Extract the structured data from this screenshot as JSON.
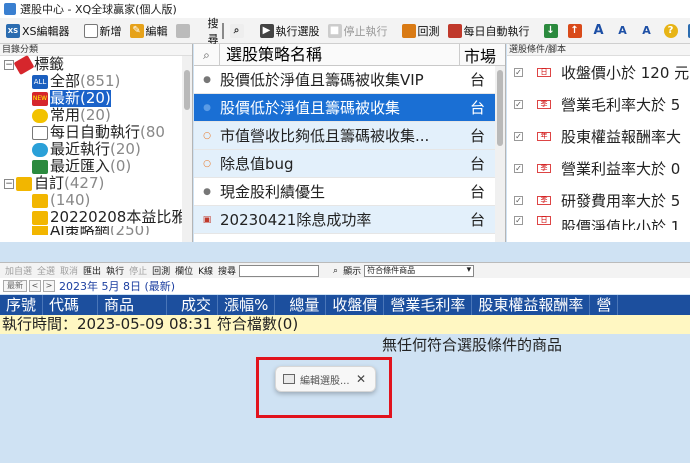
{
  "window": {
    "title": "選股中心 - XQ全球贏家(個人版)"
  },
  "toolbar": {
    "xs_editor": "XS編輯器",
    "new": "新增",
    "edit": "編輯",
    "search_label": "搜尋",
    "run": "執行選股",
    "stop": "停止執行",
    "backtest": "回測",
    "daily": "每日自動執行"
  },
  "left_panel": {
    "title": "目錄分類",
    "tree": [
      {
        "label": "標籤",
        "count": ""
      },
      {
        "label": "全部",
        "count": "(851)"
      },
      {
        "label": "最新",
        "count": "(20)"
      },
      {
        "label": "常用",
        "count": "(20)"
      },
      {
        "label": "每日自動執行",
        "count": "(80"
      },
      {
        "label": "最近執行",
        "count": "(20)"
      },
      {
        "label": "最近匯入",
        "count": "(0)"
      },
      {
        "label": "自訂",
        "count": "(427)"
      },
      {
        "label": "",
        "count": "(140)"
      },
      {
        "label": "20220208本益比雅",
        "count": ""
      },
      {
        "label": "AI策略網",
        "count": "(250)"
      }
    ]
  },
  "mid_panel": {
    "header": {
      "name": "選股策略名稱",
      "market": "市場"
    },
    "rows": [
      {
        "name": "股價低於淨值且籌碼被收集VIP",
        "market": "台"
      },
      {
        "name": "股價低於淨值且籌碼被收集",
        "market": "台"
      },
      {
        "name": "市值營收比夠低且籌碼被收集...",
        "market": "台"
      },
      {
        "name": "除息值bug",
        "market": "台"
      },
      {
        "name": "現金股利績優生",
        "market": "台"
      },
      {
        "name": "20230421除息成功率",
        "market": "台"
      }
    ]
  },
  "right_panel": {
    "title": "選股條件/腳本",
    "conditions": [
      {
        "icon_text": "日",
        "text": "收盤價小於 120 元"
      },
      {
        "icon_text": "季",
        "text": "營業毛利率大於 5"
      },
      {
        "icon_text": "年",
        "text": "股東權益報酬率大"
      },
      {
        "icon_text": "季",
        "text": "營業利益率大於 0"
      },
      {
        "icon_text": "季",
        "text": "研發費用率大於 5"
      },
      {
        "icon_text": "日",
        "text": "股價淨值比小於 1"
      }
    ]
  },
  "bottom_toolbar": {
    "add_group": "加自選",
    "select_all": "全選",
    "cancel": "取消",
    "export": "匯出",
    "run": "執行",
    "stop": "停止",
    "backtest": "回測",
    "columns": "欄位",
    "kline": "K線",
    "search": "搜尋",
    "display_label": "顯示",
    "display_value": "符合條件商品"
  },
  "date_bar": {
    "btn": "最新",
    "text": "2023年 5月 8日 (最新)"
  },
  "results": {
    "headers": [
      "序號",
      "代碼",
      "商品",
      "成交",
      "漲幅%",
      "總量",
      "收盤價",
      "營業毛利率",
      "股東權益報酬率",
      "營"
    ],
    "exec_line": "執行時間：2023-05-09 08:31 符合檔數(0)",
    "empty_text": "無任何符合選股條件的商品"
  },
  "toast": {
    "text": "編輯選股..."
  },
  "colors": {
    "selection": "#1a6fd4",
    "header_blue": "#1c4f9e",
    "highlight_box": "#e1121c"
  }
}
